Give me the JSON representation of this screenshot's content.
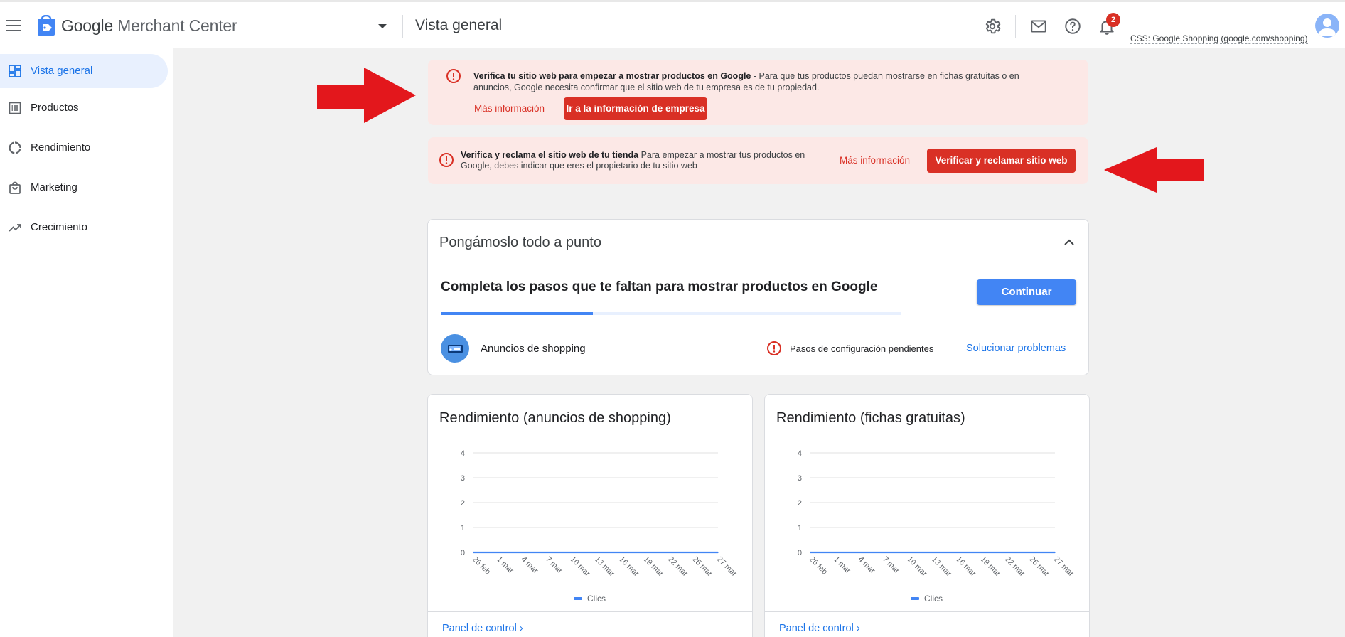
{
  "header": {
    "app_name_google": "Google",
    "app_name_rest": " Merchant Center",
    "page_title": "Vista general",
    "notification_count": "2",
    "css_label": "CSS: Google Shopping (google.com/shopping)",
    "icons": [
      "menu-icon",
      "merchant-center-logo",
      "dropdown-arrow-icon",
      "settings-gear-icon",
      "mail-icon",
      "help-icon",
      "bell-icon",
      "avatar"
    ]
  },
  "sidebar": {
    "items": [
      {
        "label": "Vista general",
        "icon": "dashboard-icon",
        "active": true
      },
      {
        "label": "Productos",
        "icon": "list-icon",
        "active": false
      },
      {
        "label": "Rendimiento",
        "icon": "donut-chart-icon",
        "active": false
      },
      {
        "label": "Marketing",
        "icon": "shopping-bag-icon",
        "active": false
      },
      {
        "label": "Crecimiento",
        "icon": "trending-up-icon",
        "active": false
      }
    ]
  },
  "banner1": {
    "title": "Verifica tu sitio web para empezar a mostrar productos en Google",
    "body": " - Para que tus productos puedan mostrarse en fichas gratuitas o en anuncios, Google necesita confirmar que el sitio web de tu empresa es de tu propiedad.",
    "link": "Más información",
    "button": "Ir a la información de empresa"
  },
  "banner2": {
    "title": "Verifica y reclama el sitio web de tu tienda",
    "body": " Para empezar a mostrar tus productos en Google, debes indicar que eres el propietario de tu sitio web",
    "link": "Más información",
    "button": "Verificar y reclamar sitio web"
  },
  "setup": {
    "card_title": "Pongámoslo todo a punto",
    "heading": "Completa los pasos que te faltan para mostrar productos en Google",
    "progress": 0.33,
    "continue_button": "Continuar",
    "program_label": "Anuncios de shopping",
    "status": "Pasos de configuración pendientes",
    "fix_link": "Solucionar problemas"
  },
  "performance": [
    {
      "title": "Rendimiento (anuncios de shopping)",
      "link": "Panel de control"
    },
    {
      "title": "Rendimiento (fichas gratuitas)",
      "link": "Panel de control"
    }
  ],
  "colors": {
    "accent_blue": "#4285f4",
    "link_blue": "#1a73e8",
    "error_red": "#d93025",
    "banner_bg": "#fce8e6",
    "arrow_red": "#e3171c"
  },
  "chart_data": [
    {
      "type": "line",
      "categories": [
        "26 feb",
        "1 mar",
        "4 mar",
        "7 mar",
        "10 mar",
        "13 mar",
        "16 mar",
        "19 mar",
        "22 mar",
        "25 mar",
        "27 mar"
      ],
      "series": [
        {
          "name": "Clics",
          "values": [
            0,
            0,
            0,
            0,
            0,
            0,
            0,
            0,
            0,
            0,
            0
          ]
        }
      ],
      "yticks": [
        0,
        1,
        2,
        3,
        4
      ],
      "ylim": [
        0,
        4
      ],
      "grid": true,
      "legend": "bottom"
    },
    {
      "type": "line",
      "categories": [
        "26 feb",
        "1 mar",
        "4 mar",
        "7 mar",
        "10 mar",
        "13 mar",
        "16 mar",
        "19 mar",
        "22 mar",
        "25 mar",
        "27 mar"
      ],
      "series": [
        {
          "name": "Clics",
          "values": [
            0,
            0,
            0,
            0,
            0,
            0,
            0,
            0,
            0,
            0,
            0
          ]
        }
      ],
      "yticks": [
        0,
        1,
        2,
        3,
        4
      ],
      "ylim": [
        0,
        4
      ],
      "grid": true,
      "legend": "bottom"
    }
  ]
}
